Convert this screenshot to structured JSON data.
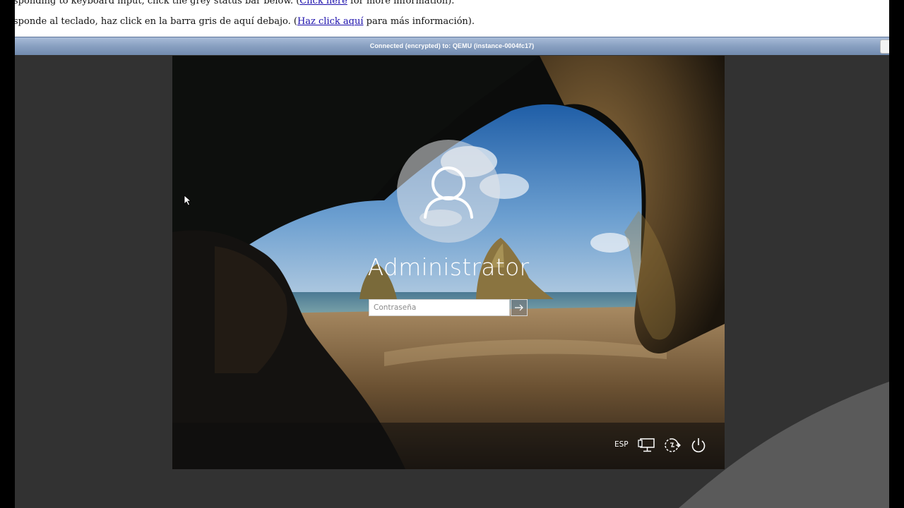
{
  "info_bar": {
    "line1_text": "sponding to keyboard input, click the grey status bar below. (",
    "line1_link": "Click here",
    "line1_tail": " for more information).",
    "line2_text": "sponde al teclado, haz click en la barra gris de aquí debajo. (",
    "line2_link": "Haz click aquí",
    "line2_tail": " para más información)."
  },
  "status_bar": {
    "text": "Connected (encrypted) to: QEMU (instance-0004fc17)"
  },
  "lock_screen": {
    "username": "Administrator",
    "password_placeholder": "Contraseña",
    "password_value": "",
    "language": "ESP",
    "icons": [
      "user-avatar-icon",
      "submit-arrow-icon",
      "network-icon",
      "ease-of-access-icon",
      "power-icon"
    ]
  },
  "colors": {
    "status_bar": "#8aa1c2",
    "vnc_background": "#323232",
    "link": "#1a0dab"
  }
}
